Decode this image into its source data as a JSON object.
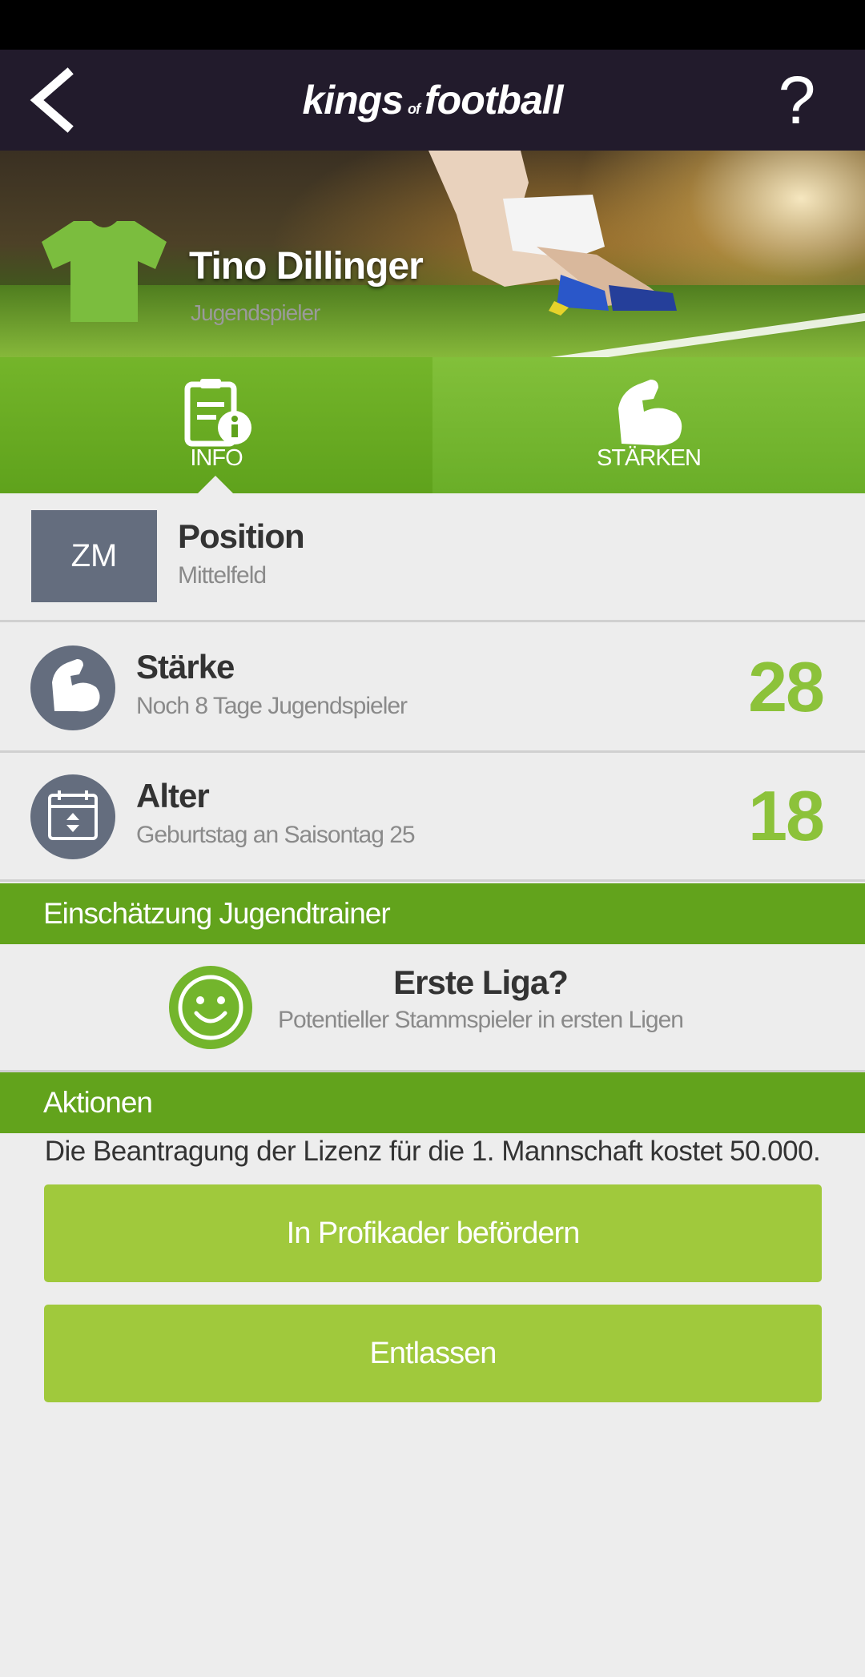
{
  "app": {
    "logo_kings": "kings",
    "logo_of": "of",
    "logo_football": "football",
    "help_label": "?"
  },
  "player": {
    "name": "Tino Dillinger",
    "role": "Jugendspieler"
  },
  "tabs": [
    {
      "label": "INFO",
      "icon": "info-clipboard-icon",
      "active": true
    },
    {
      "label": "STÄRKEN",
      "icon": "flexed-arm-icon",
      "active": false
    }
  ],
  "position": {
    "badge": "ZM",
    "title": "Position",
    "subtitle": "Mittelfeld"
  },
  "staerke": {
    "title": "Stärke",
    "subtitle": "Noch 8 Tage Jugendspieler",
    "value": "28"
  },
  "alter": {
    "title": "Alter",
    "subtitle": "Geburtstag an Saisontag 25",
    "value": "18"
  },
  "evaluation": {
    "header": "Einschätzung Jugendtrainer",
    "title": "Erste Liga?",
    "subtitle": "Potentieller Stammspieler in ersten Ligen",
    "icon": "smiley-icon"
  },
  "actions": {
    "header": "Aktionen",
    "license_note": "Die Beantragung der Lizenz für die 1. Mannschaft kostet 50.000.",
    "promote_label": "In Profikader befördern",
    "release_label": "Entlassen"
  },
  "colors": {
    "topbar": "#221b2c",
    "green_dark": "#62a31c",
    "green_button": "#a0c93c",
    "value_green": "#8cc23a",
    "badge_grey": "#646d7e",
    "background": "#ededed"
  }
}
